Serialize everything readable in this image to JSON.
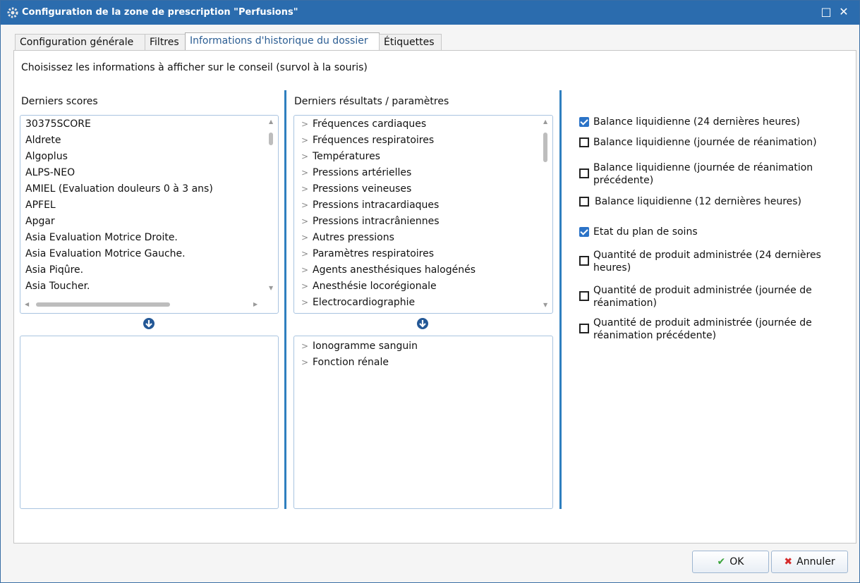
{
  "window": {
    "title": "Configuration de la zone de prescription \"Perfusions\"",
    "maximize_glyph": "□",
    "close_glyph": "✕"
  },
  "tabs": [
    {
      "label": "Configuration générale"
    },
    {
      "label": "Filtres"
    },
    {
      "label": "Informations d'historique du dossier"
    },
    {
      "label": "Étiquettes"
    }
  ],
  "instruction": "Choisissez les informations à afficher sur le conseil (survol à la souris)",
  "scores": {
    "label": "Derniers scores",
    "items": [
      "30375SCORE",
      "Aldrete",
      "Algoplus",
      "ALPS-NEO",
      "AMIEL (Evaluation douleurs 0 à 3 ans)",
      "APFEL",
      "Apgar",
      "Asia Evaluation Motrice Droite.",
      "Asia Evaluation Motrice Gauche.",
      "Asia Piqûre.",
      "Asia Toucher."
    ]
  },
  "results": {
    "label": "Derniers résultats / paramètres",
    "items": [
      "Fréquences cardiaques",
      "Fréquences respiratoires",
      "Températures",
      "Pressions artérielles",
      "Pressions veineuses",
      "Pressions intracardiaques",
      "Pressions intracrâniennes",
      "Autres pressions",
      "Paramètres respiratoires",
      "Agents anesthésiques halogénés",
      "Anesthésie locorégionale",
      "Electrocardiographie"
    ],
    "selected": [
      "Ionogramme sanguin",
      "Fonction rénale"
    ]
  },
  "options": [
    {
      "label_lines": [
        "Balance liquidienne (24 dernières heures)"
      ],
      "checked": true
    },
    {
      "label_lines": [
        "Balance liquidienne (journée de réanimation)"
      ],
      "checked": false
    },
    {
      "label_lines": [
        "Balance liquidienne (journée de réanimation",
        "précédente)"
      ],
      "checked": false
    },
    {
      "label_lines": [
        " Balance liquidienne (12 dernières heures)"
      ],
      "checked": false
    },
    {
      "label_lines": [
        "Etat du plan de soins"
      ],
      "checked": true
    },
    {
      "label_lines": [
        "Quantité de produit administrée (24 dernières",
        "heures)"
      ],
      "checked": false
    },
    {
      "label_lines": [
        "Quantité de produit administrée (journée de",
        "réanimation)"
      ],
      "checked": false
    },
    {
      "label_lines": [
        "Quantité de produit administrée (journée de",
        "réanimation précédente)"
      ],
      "checked": false
    }
  ],
  "buttons": {
    "ok": "OK",
    "cancel": "Annuler"
  },
  "colors": {
    "titlebar": "#2b6cae",
    "accent": "#2b73c7",
    "ok_icon": "#3aa33a",
    "cancel_icon": "#d52b2b"
  }
}
